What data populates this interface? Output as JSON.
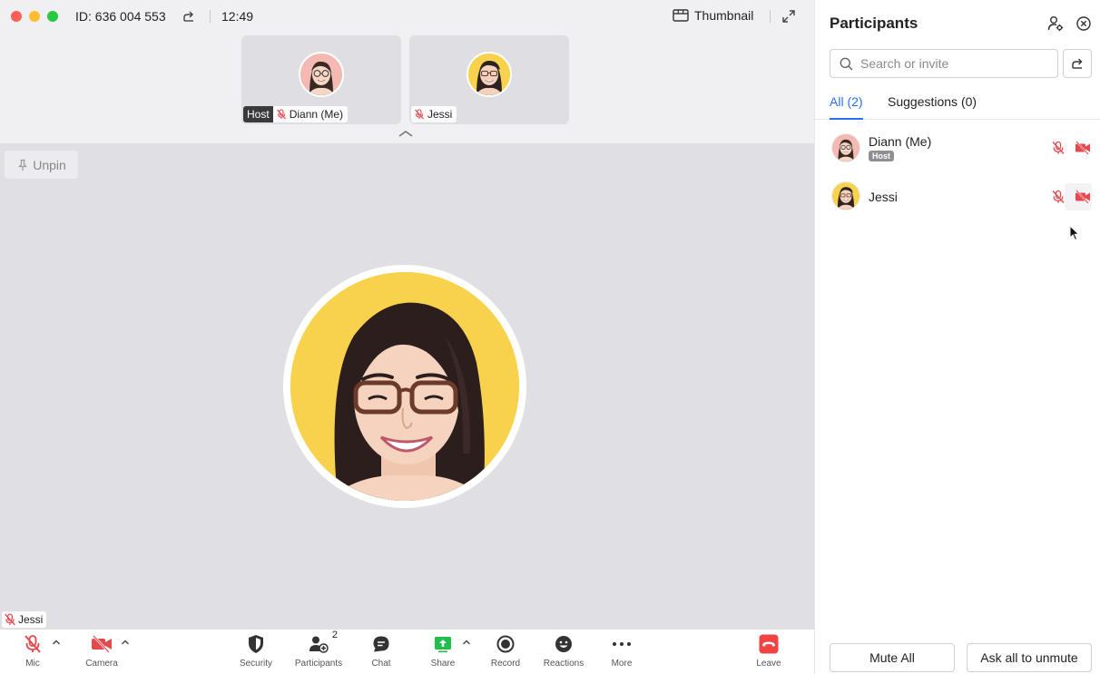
{
  "meeting": {
    "id_label": "ID: 636 004 553",
    "time": "12:49",
    "view_label": "Thumbnail"
  },
  "tiles": [
    {
      "host_tag": "Host",
      "name": "Diann (Me)"
    },
    {
      "name": "Jessi"
    }
  ],
  "stage": {
    "unpin_label": "Unpin",
    "speaker_name": "Jessi"
  },
  "toolbar": {
    "mic_label": "Mic",
    "camera_label": "Camera",
    "security_label": "Security",
    "participants_label": "Participants",
    "participants_count": "2",
    "chat_label": "Chat",
    "share_label": "Share",
    "record_label": "Record",
    "reactions_label": "Reactions",
    "more_label": "More",
    "leave_label": "Leave"
  },
  "panel": {
    "title": "Participants",
    "search_placeholder": "Search or invite",
    "tab_all": "All (2)",
    "tab_suggestions": "Suggestions (0)",
    "participants": [
      {
        "name": "Diann (Me)",
        "role": "Host"
      },
      {
        "name": "Jessi"
      }
    ],
    "mute_all_label": "Mute All",
    "ask_unmute_label": "Ask all to unmute"
  },
  "colors": {
    "accent": "#2a6ff0",
    "muted_red": "#e5484d",
    "share_green": "#1fbf4a",
    "leave_red": "#f04343",
    "avatar_yellow": "#f9d24d",
    "avatar_pink": "#f4b9b2"
  }
}
